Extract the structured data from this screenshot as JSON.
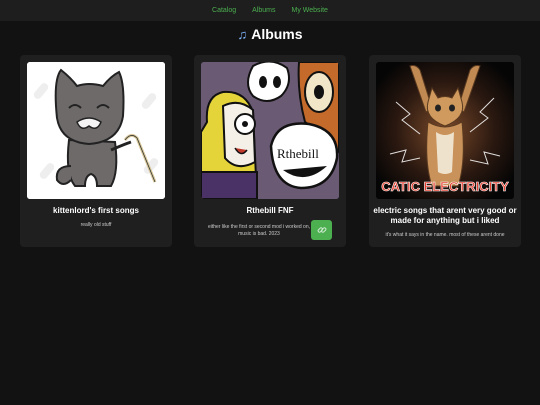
{
  "nav": {
    "items": [
      {
        "label": "Catalog"
      },
      {
        "label": "Albums"
      },
      {
        "label": "My Website"
      }
    ]
  },
  "page": {
    "title_icon": "music-note-icon",
    "title": "Albums"
  },
  "albums": [
    {
      "title": "kittenlord's first songs",
      "description": "really old stuff",
      "cover": "cartoon-cat-with-cane-image"
    },
    {
      "title": "Rthebill FNF",
      "description": "either like the first or second mod i worked on, music is bad. 2023",
      "cover": "cartoon-characters-image",
      "cover_text": "Rthebill",
      "link_icon": "link-icon"
    },
    {
      "title": "electric songs that arent very good or made for anything but i liked",
      "description": "it's what it says in the name. most of these arent done",
      "cover": "cat-lightning-photo",
      "cover_text": "CATIC ELECTRICITY"
    }
  ],
  "colors": {
    "background": "#121212",
    "nav_background": "#1e1e1e",
    "card_background": "#1f1f1f",
    "accent": "#4caf50"
  }
}
